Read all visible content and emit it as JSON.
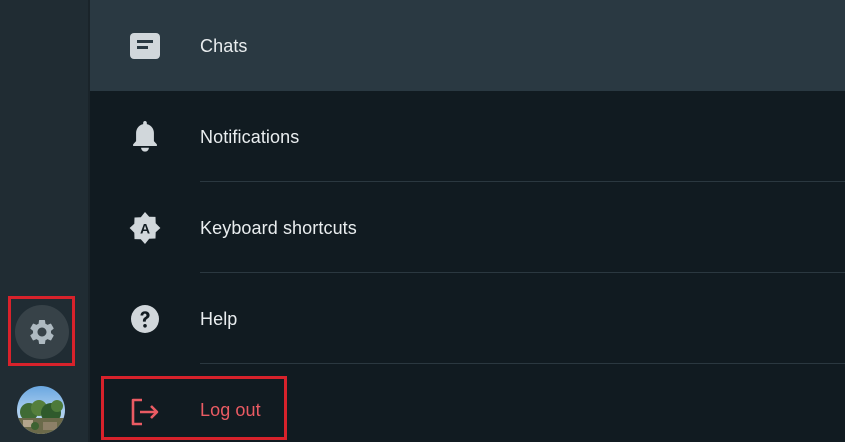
{
  "rail": {
    "settings_icon": "gear-icon",
    "avatar_icon": "profile-avatar"
  },
  "menu": {
    "items": [
      {
        "label": "Chats",
        "icon": "chats-icon",
        "active": true
      },
      {
        "label": "Notifications",
        "icon": "bell-icon",
        "active": false
      },
      {
        "label": "Keyboard shortcuts",
        "icon": "keyboard-shortcuts-icon",
        "active": false
      },
      {
        "label": "Help",
        "icon": "help-icon",
        "active": false
      },
      {
        "label": "Log out",
        "icon": "logout-icon",
        "active": false
      }
    ]
  },
  "colors": {
    "background": "#111b21",
    "rail": "#202c33",
    "active_item": "#2a3942",
    "text": "#e9edef",
    "danger": "#ea5b63",
    "highlight_box": "#d8222b"
  }
}
